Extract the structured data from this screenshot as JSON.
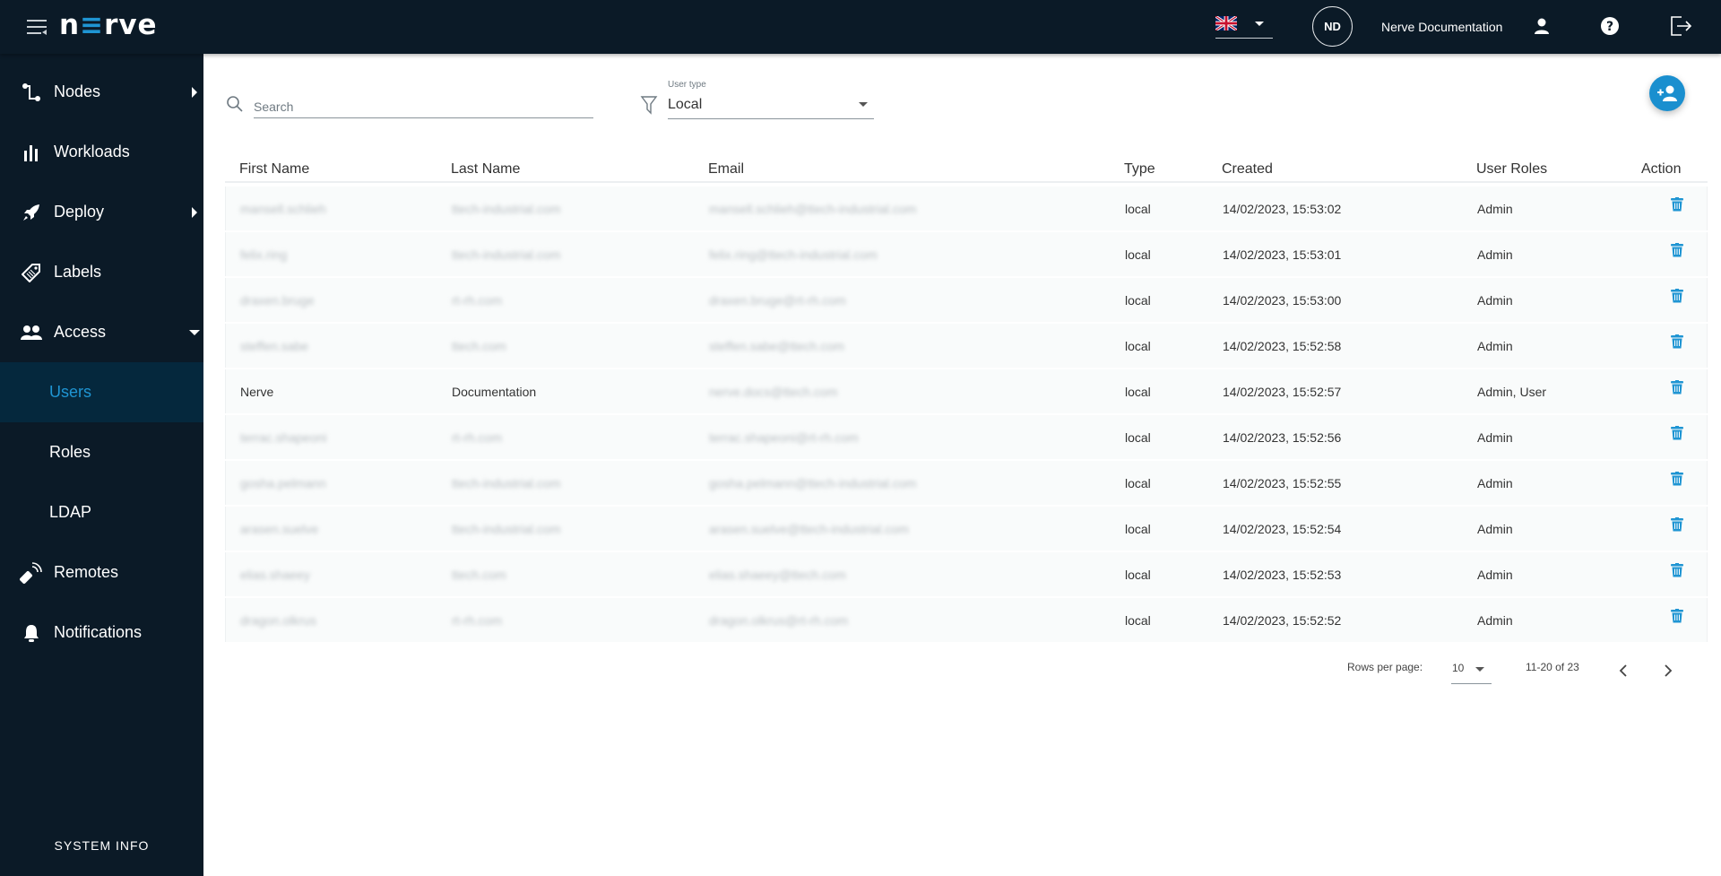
{
  "app": {
    "logo_text_n": "n",
    "logo_text_e": "≡",
    "logo_text_rest": "rve",
    "logo_full": "nerve"
  },
  "topbar": {
    "language": "en-GB",
    "avatar_initials": "ND",
    "user_name": "Nerve Documentation",
    "icons": [
      "profile-icon",
      "help-icon",
      "logout-icon"
    ]
  },
  "sidebar": {
    "items": [
      {
        "label": "Nodes",
        "icon": "nodes-icon",
        "expandable": "right"
      },
      {
        "label": "Workloads",
        "icon": "workloads-icon",
        "expandable": ""
      },
      {
        "label": "Deploy",
        "icon": "rocket-icon",
        "expandable": "right"
      },
      {
        "label": "Labels",
        "icon": "label-icon",
        "expandable": ""
      },
      {
        "label": "Access",
        "icon": "users-icon",
        "expandable": "down"
      }
    ],
    "sub_items": [
      {
        "label": "Users",
        "active": true
      },
      {
        "label": "Roles",
        "active": false
      },
      {
        "label": "LDAP",
        "active": false
      }
    ],
    "bottom_items": [
      {
        "label": "Remotes",
        "icon": "remote-icon"
      },
      {
        "label": "Notifications",
        "icon": "bell-icon"
      }
    ],
    "system_info": "SYSTEM INFO"
  },
  "toolbar": {
    "search_placeholder": "Search",
    "search_value": "",
    "user_type_label": "User type",
    "user_type_value": "Local",
    "add_user_icon": "add-user-icon"
  },
  "table": {
    "columns": [
      "First Name",
      "Last Name",
      "Email",
      "Type",
      "Created",
      "User Roles",
      "Action"
    ],
    "rows": [
      {
        "first": "mansell.schlieh",
        "last": "ttech-industrial.com",
        "email": "mansell.schlieh@ttech-industrial.com",
        "type": "local",
        "created": "14/02/2023, 15:53:02",
        "roles": "Admin",
        "blurred": true
      },
      {
        "first": "felix.ring",
        "last": "ttech-industrial.com",
        "email": "felix.ring@ttech-industrial.com",
        "type": "local",
        "created": "14/02/2023, 15:53:01",
        "roles": "Admin",
        "blurred": true
      },
      {
        "first": "draxen.bruge",
        "last": "rt-rh.com",
        "email": "draxen.bruge@rt-rh.com",
        "type": "local",
        "created": "14/02/2023, 15:53:00",
        "roles": "Admin",
        "blurred": true
      },
      {
        "first": "steffen.sabe",
        "last": "ttech.com",
        "email": "steffen.sabe@ttech.com",
        "type": "local",
        "created": "14/02/2023, 15:52:58",
        "roles": "Admin",
        "blurred": true
      },
      {
        "first": "Nerve",
        "last": "Documentation",
        "email": "nerve.docs@ttech.com",
        "type": "local",
        "created": "14/02/2023, 15:52:57",
        "roles": "Admin, User",
        "blurred": false,
        "email_blurred": true
      },
      {
        "first": "terrac.shapeoni",
        "last": "rt-rh.com",
        "email": "terrac.shapeoni@rt-rh.com",
        "type": "local",
        "created": "14/02/2023, 15:52:56",
        "roles": "Admin",
        "blurred": true
      },
      {
        "first": "gosha.pelmann",
        "last": "ttech-industrial.com",
        "email": "gosha.pelmann@ttech-industrial.com",
        "type": "local",
        "created": "14/02/2023, 15:52:55",
        "roles": "Admin",
        "blurred": true
      },
      {
        "first": "arasen.suelve",
        "last": "ttech-industrial.com",
        "email": "arasen.suelve@ttech-industrial.com",
        "type": "local",
        "created": "14/02/2023, 15:52:54",
        "roles": "Admin",
        "blurred": true
      },
      {
        "first": "elias.shaeey",
        "last": "ttech.com",
        "email": "elias.shaeey@ttech.com",
        "type": "local",
        "created": "14/02/2023, 15:52:53",
        "roles": "Admin",
        "blurred": true
      },
      {
        "first": "dragon.olkrus",
        "last": "rt-rh.com",
        "email": "dragon.olkrus@rt-rh.com",
        "type": "local",
        "created": "14/02/2023, 15:52:52",
        "roles": "Admin",
        "blurred": true
      }
    ]
  },
  "pagination": {
    "rows_per_page_label": "Rows per page:",
    "rows_per_page": "10",
    "range": "11-20 of 23"
  },
  "colors": {
    "accent": "#1f95d3",
    "sidebar_bg": "#0b1a27",
    "active_bg": "#05283d",
    "row_bg": "#f9fbfb"
  }
}
